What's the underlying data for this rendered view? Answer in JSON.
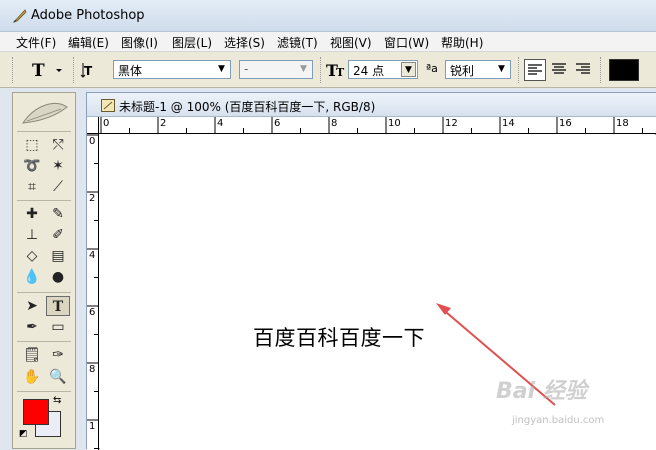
{
  "app": {
    "title": "Adobe Photoshop"
  },
  "menu": [
    "文件(F)",
    "编辑(E)",
    "图像(I)",
    "图层(L)",
    "选择(S)",
    "滤镜(T)",
    "视图(V)",
    "窗口(W)",
    "帮助(H)"
  ],
  "options": {
    "font_family": "黑体",
    "font_style": "-",
    "font_size": "24 点",
    "aa_label": "ªa",
    "antialias": "锐利",
    "text_color": "#000000"
  },
  "toolbox": {
    "foreground": "#ff0000",
    "background": "#ececf7"
  },
  "document": {
    "title": "未标题-1 @ 100% (百度百科百度一下, RGB/8)",
    "ruler_h": [
      "0",
      "2",
      "4",
      "6",
      "8",
      "10",
      "12",
      "14",
      "16",
      "18"
    ],
    "ruler_v": [
      "0",
      "2",
      "4",
      "6",
      "8",
      "1"
    ],
    "canvas_text": "百度百科百度一下"
  },
  "watermark": {
    "brand": "Bai 经验",
    "url": "jingyan.baidu.com"
  },
  "annotation": {
    "color": "#e05050"
  }
}
